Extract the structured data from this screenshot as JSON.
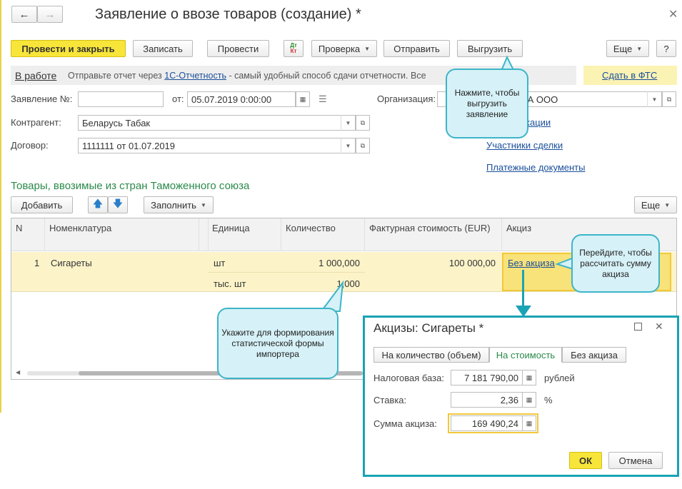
{
  "window": {
    "title": "Заявление о ввозе товаров (создание) *"
  },
  "toolbar": {
    "post_close": "Провести и закрыть",
    "save": "Записать",
    "post": "Провести",
    "dtkt_top": "Дт",
    "dtkt_bottom": "Кт",
    "check": "Проверка",
    "send": "Отправить",
    "upload": "Выгрузить",
    "more": "Еще",
    "help": "?"
  },
  "status": {
    "state": "В работе",
    "text_before": "Отправьте отчет через ",
    "link": "1С-Отчетность",
    "text_after": " - самый удобный способ сдачи отчетности. Все",
    "fts_link": "Сдать в ФТС"
  },
  "form": {
    "number_label": "Заявление №:",
    "number_value": "",
    "date_label": "от:",
    "date_value": "05.07.2019  0:00:00",
    "org_label": "Организация:",
    "org_value": "КА ООО",
    "counterparty_label": "Контрагент:",
    "counterparty_value": "Беларусь Табак",
    "contract_label": "Договор:",
    "contract_value": "1111111 от 01.07.2019",
    "link_specs": "кации",
    "link_participants": "Участники сделки",
    "link_payments": "Платежные документы"
  },
  "goods": {
    "section_title": "Товары, ввозимые из стран Таможенного союза",
    "add": "Добавить",
    "fill": "Заполнить",
    "more": "Еще",
    "columns": [
      "N",
      "Номенклатура",
      "Единица",
      "Количество",
      "Фактурная стоимость (EUR)",
      "Акциз"
    ],
    "row": {
      "n": "1",
      "item": "Сигареты",
      "unit1": "шт",
      "unit2": "тыс. шт",
      "qty1": "1 000,000",
      "qty2": "1,000",
      "cost": "100 000,00",
      "excise": "Без акциза"
    }
  },
  "dialog": {
    "title": "Акцизы: Сигареты *",
    "tabs": [
      "На количество (объем)",
      "На стоимость",
      "Без акциза"
    ],
    "tax_base_label": "Налоговая база:",
    "tax_base_value": "7 181 790,00",
    "tax_base_unit": "рублей",
    "rate_label": "Ставка:",
    "rate_value": "2,36",
    "rate_unit": "%",
    "sum_label": "Сумма акциза:",
    "sum_value": "169 490,24",
    "ok": "ОК",
    "cancel": "Отмена"
  },
  "callouts": {
    "upload": "Нажмите, чтобы выгрузить заявление",
    "excise": "Перейдите, чтобы рассчитать сумму акциза",
    "qty": "Укажите для формирования статистической формы импортера"
  },
  "colors": {
    "accent_yellow": "#f8e53a",
    "callout_border": "#3db5c9",
    "dialog_border": "#1aa3b5",
    "section_green": "#2a8a4a",
    "link_blue": "#1a4f9b"
  }
}
